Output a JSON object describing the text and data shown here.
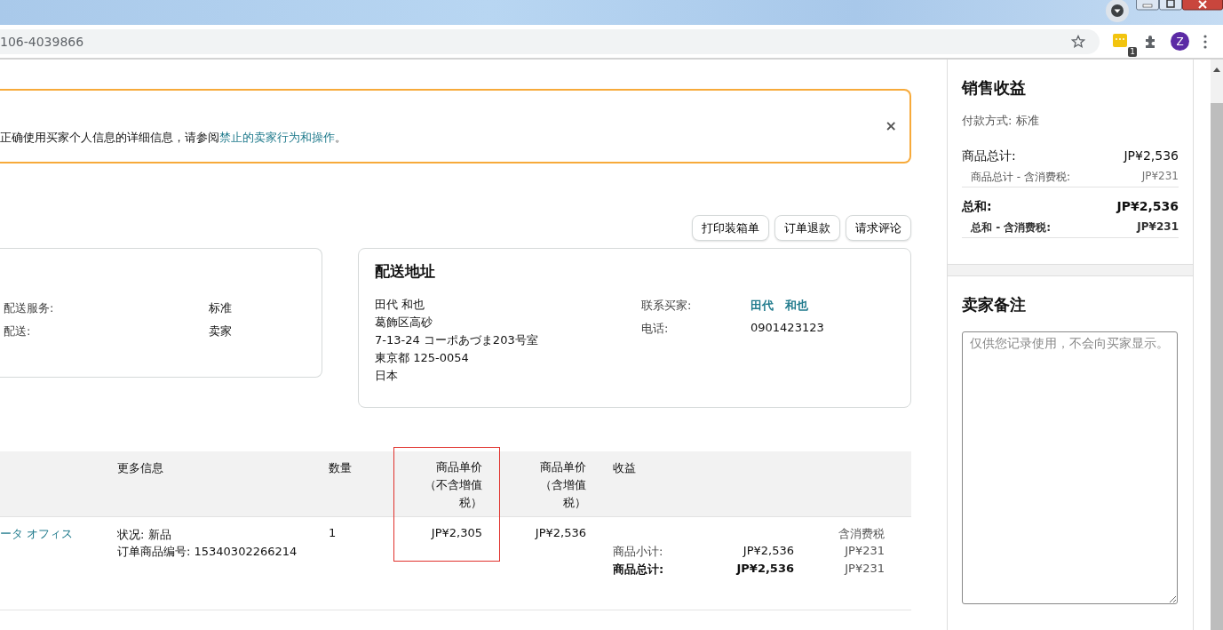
{
  "browser": {
    "url": "106-4039866",
    "extension_badge": "1",
    "profile_initial": "Z"
  },
  "alert": {
    "text": "正确使用买家个人信息的详细信息，请参阅",
    "link": "禁止的卖家行为和操作",
    "tail": "。",
    "close": "×"
  },
  "actions": [
    "打印装箱单",
    "订单退款",
    "请求评论"
  ],
  "shipping_card": {
    "rows": [
      {
        "label": "配送服务:",
        "value": "标准"
      },
      {
        "label": "配送:",
        "value": "卖家"
      }
    ]
  },
  "address_card": {
    "title": "配送地址",
    "lines": [
      "田代 和也",
      "葛飾区高砂",
      "7-13-24 コーポあづま203号室",
      "東京都 125-0054",
      "日本"
    ],
    "contact": [
      {
        "label": "联系买家:",
        "value": "田代　和也",
        "kind": "link"
      },
      {
        "label": "电话:",
        "value": "0901423123",
        "kind": "text"
      }
    ]
  },
  "table": {
    "columns": [
      {
        "label": "更多信息",
        "highlighted": false
      },
      {
        "label": "数量",
        "highlighted": false
      },
      {
        "label": "商品单价（不含增值税）",
        "highlighted": true
      },
      {
        "label": "商品单价（含增值税）",
        "highlighted": false
      },
      {
        "label": "收益",
        "highlighted": false
      }
    ],
    "rows": [
      {
        "product": "ータ オフィス",
        "details": [
          "状况: 新品",
          "订单商品编号: 15340302266214"
        ],
        "quantity": "1",
        "unit_price_ex_tax": "JP¥2,305",
        "unit_price_inc_tax": "JP¥2,536",
        "revenue": {
          "tax_heading": "含消费税",
          "lines": [
            {
              "label": "商品小计:",
              "amount": "JP¥2,536",
              "tax": "JP¥231",
              "bold": false
            },
            {
              "label": "商品总计:",
              "amount": "JP¥2,536",
              "tax": "JP¥231",
              "bold": true
            }
          ]
        }
      }
    ]
  },
  "sales": {
    "title": "销售收益",
    "payment": "付款方式: 标准",
    "lines": [
      {
        "label": "商品总计:",
        "amount": "JP¥2,536",
        "bold": false,
        "sub_label": "商品总计 - 含消费税:",
        "sub_amount": "JP¥231"
      },
      {
        "label": "总和:",
        "amount": "JP¥2,536",
        "bold": true,
        "sub_label": "总和 - 含消费税:",
        "sub_amount": "JP¥231"
      }
    ]
  },
  "notes": {
    "title": "卖家备注",
    "placeholder": "仅供您记录使用，不会向买家显示。"
  }
}
